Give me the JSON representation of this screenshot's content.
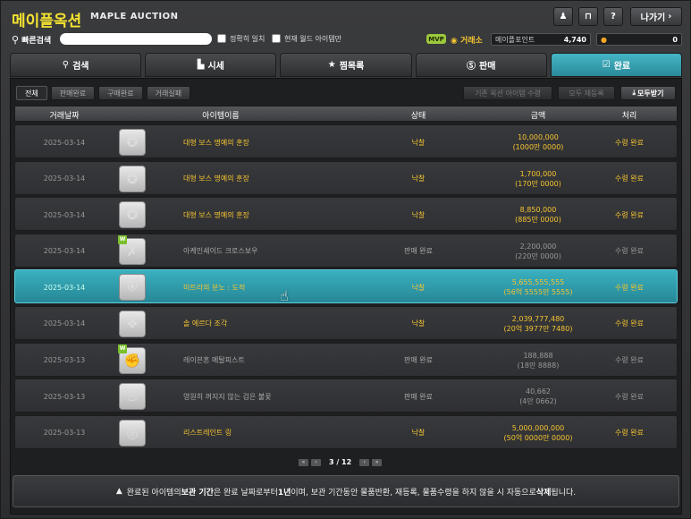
{
  "header": {
    "title": "메이플옥션",
    "subtitle": "MAPLE AUCTION",
    "buttons": {
      "exit_label": "나가기"
    }
  },
  "search": {
    "label": "빠른검색",
    "placeholder": "",
    "exact_match": "정확히 일치",
    "current_world": "현재 월드 아이템만"
  },
  "currency": {
    "mvp": "MVP",
    "exchange_label": "거래소",
    "maple_points_label": "메이플포인트",
    "maple_points_value": "4,740",
    "meso_value": "0"
  },
  "tabs": [
    {
      "label": "검색",
      "icon": "search-icon"
    },
    {
      "label": "시세",
      "icon": "chart-icon"
    },
    {
      "label": "찜목록",
      "icon": "star-icon"
    },
    {
      "label": "판매",
      "icon": "coin-icon"
    },
    {
      "label": "완료",
      "icon": "check-icon"
    }
  ],
  "filters": [
    "전체",
    "판매완료",
    "구매완료",
    "거래실패"
  ],
  "actions": {
    "base_option": "기존 옥션 아이템 수령",
    "bulk_reregister": "모두 재등록",
    "receive_all": "모두받기"
  },
  "table": {
    "headers": [
      "거래날짜",
      "아이템이름",
      "상태",
      "금액",
      "처리"
    ],
    "rows": [
      {
        "date": "2025-03-14",
        "name": "대형 보스 명예의 훈장",
        "icon": "medal-icon",
        "w": false,
        "status": "낙찰",
        "amount": "10,000,000",
        "amount_sub": "(1000만 0000)",
        "proc": "수령 완료",
        "style": "gold"
      },
      {
        "date": "2025-03-14",
        "name": "대형 보스 명예의 훈장",
        "icon": "medal-icon",
        "w": false,
        "status": "낙찰",
        "amount": "1,700,000",
        "amount_sub": "(170만 0000)",
        "proc": "수령 완료",
        "style": "gold"
      },
      {
        "date": "2025-03-14",
        "name": "대형 보스 명예의 훈장",
        "icon": "medal-icon",
        "w": false,
        "status": "낙찰",
        "amount": "8,850,000",
        "amount_sub": "(885만 0000)",
        "proc": "수령 완료",
        "style": "gold"
      },
      {
        "date": "2025-03-14",
        "name": "아케인셰이드 크로스보우",
        "icon": "crossbow-icon",
        "w": true,
        "status": "판매 완료",
        "amount": "2,200,000",
        "amount_sub": "(220만 0000)",
        "proc": "수령 완료",
        "style": "gray"
      },
      {
        "date": "2025-03-14",
        "name": "미트라의 분노 : 도적",
        "icon": "emblem-icon",
        "w": false,
        "status": "낙찰",
        "amount": "5,655,555,555",
        "amount_sub": "(56억 5555만 5555)",
        "proc": "수령 완료",
        "style": "sel"
      },
      {
        "date": "2025-03-14",
        "name": "솔 에르다 조각",
        "icon": "crystal-icon",
        "w": false,
        "status": "낙찰",
        "amount": "2,039,777,480",
        "amount_sub": "(20억 3977만 7480)",
        "proc": "수령 완료",
        "style": "gold"
      },
      {
        "date": "2025-03-13",
        "name": "레이븐혼 메탈피스트",
        "icon": "fist-icon",
        "w": true,
        "status": "판매 완료",
        "amount": "188,888",
        "amount_sub": "(18만 8888)",
        "proc": "수령 완료",
        "style": "gray"
      },
      {
        "date": "2025-03-13",
        "name": "영원히 꺼지지 않는 검은 불꽃",
        "icon": "flame-icon",
        "w": false,
        "status": "판매 완료",
        "amount": "40,662",
        "amount_sub": "(4만 0662)",
        "proc": "수령 완료",
        "style": "gray"
      },
      {
        "date": "2025-03-13",
        "name": "리스트레인트 링",
        "icon": "ring-icon",
        "w": false,
        "status": "낙찰",
        "amount": "5,000,000,000",
        "amount_sub": "(50억 0000만 0000)",
        "proc": "수령 완료",
        "style": "gold"
      }
    ]
  },
  "pager": {
    "text": "3 / 12"
  },
  "notice": {
    "part1": "완료된 아이템의 ",
    "bold1": "보관 기간",
    "part2": "은 완료 날짜로부터 ",
    "bold2": "1년",
    "part3": "이며, 보관 기간동안 물품반환, 재등록, 물품수령을 하지 않을 시 자동으로 ",
    "bold3": "삭제",
    "part4": "됩니다."
  }
}
